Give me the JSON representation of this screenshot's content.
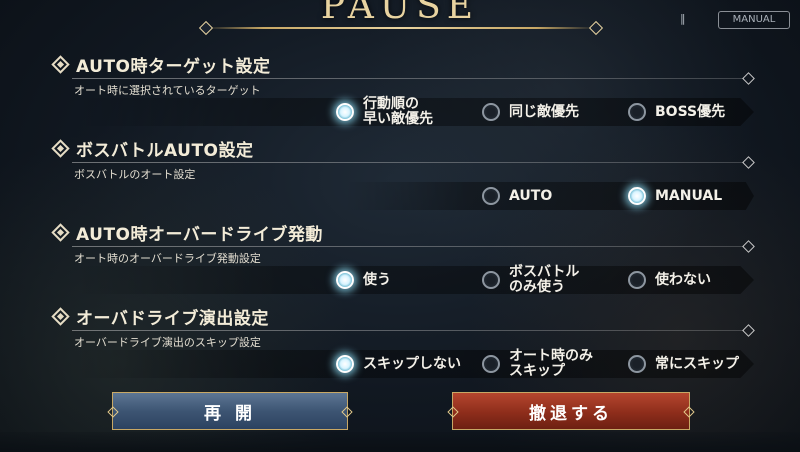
{
  "header": {
    "title": "PAUSE",
    "manual_tag": "MANUAL"
  },
  "sections": [
    {
      "title": "AUTO時ターゲット設定",
      "subtitle": "オート時に選択されているターゲット",
      "options": [
        {
          "label": "行動順の\n早い敵優先",
          "selected": true
        },
        {
          "label": "同じ敵優先",
          "selected": false
        },
        {
          "label": "BOSS優先",
          "selected": false
        }
      ]
    },
    {
      "title": "ボスバトルAUTO設定",
      "subtitle": "ボスバトルのオート設定",
      "options": [
        {
          "label": "AUTO",
          "selected": false
        },
        {
          "label": "MANUAL",
          "selected": true
        }
      ]
    },
    {
      "title": "AUTO時オーバードライブ発動",
      "subtitle": "オート時のオーバードライブ発動設定",
      "options": [
        {
          "label": "使う",
          "selected": true
        },
        {
          "label": "ボスバトル\nのみ使う",
          "selected": false
        },
        {
          "label": "使わない",
          "selected": false
        }
      ]
    },
    {
      "title": "オーバドライブ演出設定",
      "subtitle": "オーバードライブ演出のスキップ設定",
      "options": [
        {
          "label": "スキップしない",
          "selected": true
        },
        {
          "label": "オート時のみ\nスキップ",
          "selected": false
        },
        {
          "label": "常にスキップ",
          "selected": false
        }
      ]
    }
  ],
  "buttons": {
    "resume": "再 開",
    "retreat": "撤退する"
  }
}
